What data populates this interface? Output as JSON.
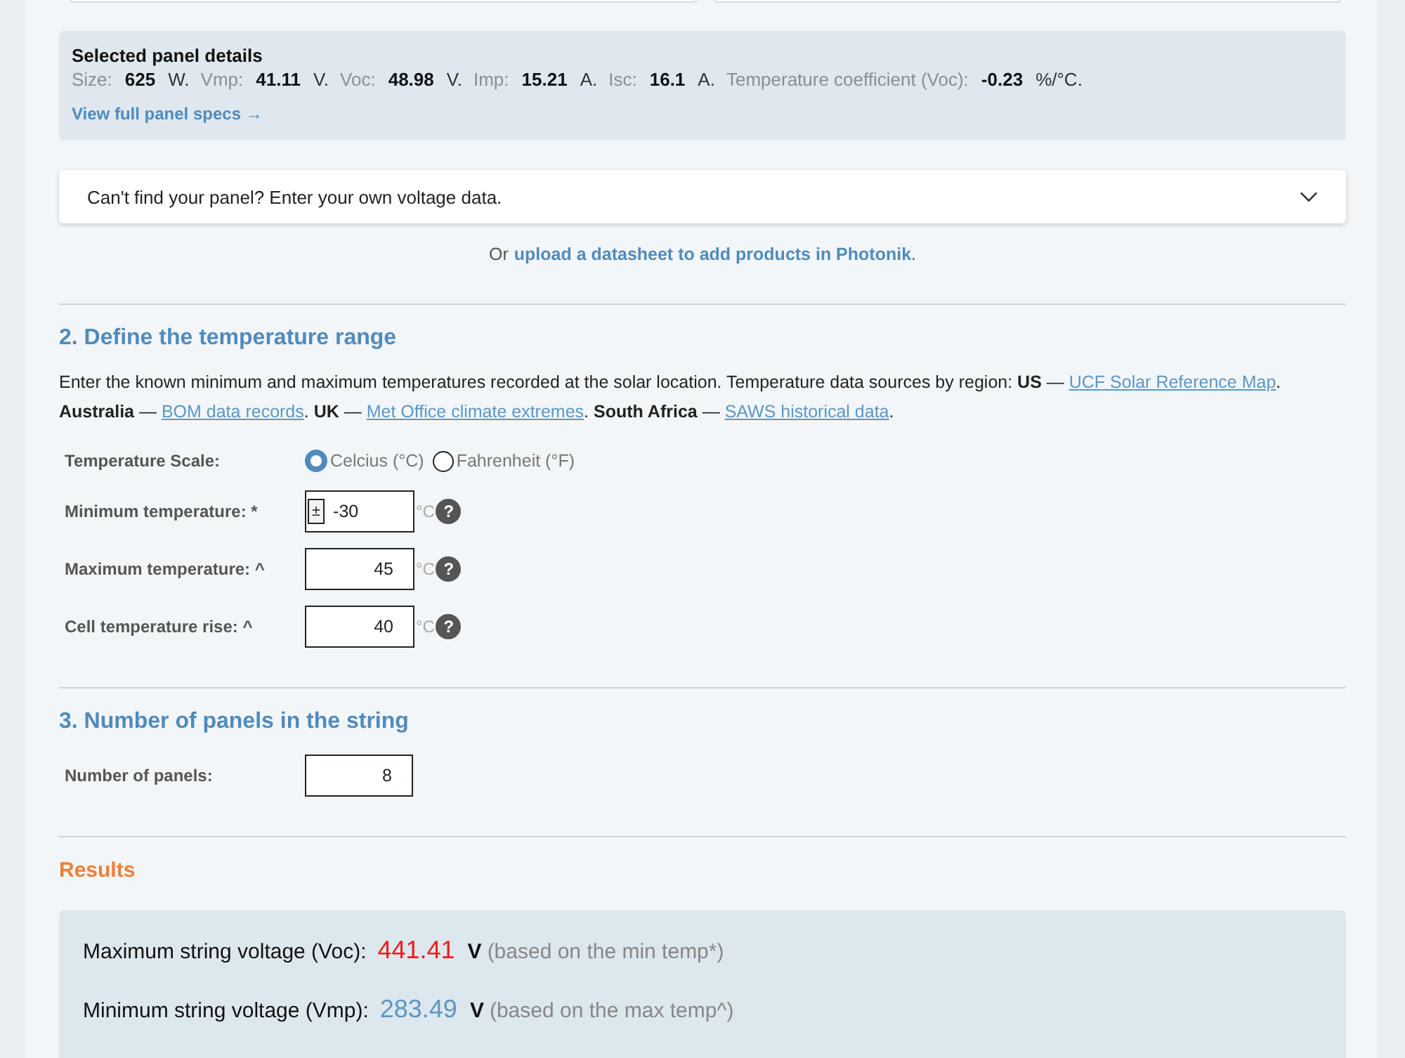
{
  "panel_details": {
    "title": "Selected panel details",
    "specs": [
      {
        "label": "Size:",
        "value": "625",
        "unit": "W."
      },
      {
        "label": "Vmp:",
        "value": "41.11",
        "unit": "V."
      },
      {
        "label": "Voc:",
        "value": "48.98",
        "unit": "V."
      },
      {
        "label": "Imp:",
        "value": "15.21",
        "unit": "A."
      },
      {
        "label": "Isc:",
        "value": "16.1",
        "unit": "A."
      },
      {
        "label": "Temperature coefficient (Voc):",
        "value": "-0.23",
        "unit": "%/°C."
      }
    ],
    "link": "View full panel specs →"
  },
  "custom_entry": {
    "label": "Can't find your panel? Enter your own voltage data.",
    "expanded": false
  },
  "upload_note": {
    "prefix": "Or",
    "link": "upload a datasheet to add products in Photonik",
    "suffix": "."
  },
  "temperature_section": {
    "heading": "2. Define the temperature range",
    "description": [
      {
        "kind": "text",
        "text": "Enter the known minimum and maximum temperatures recorded at the solar location. Temperature data sources by region: **US** — "
      },
      {
        "kind": "link",
        "text": "UCF Solar Reference Map"
      },
      {
        "kind": "text",
        "text": ". **Australia** — "
      },
      {
        "kind": "link",
        "text": "BOM data records"
      },
      {
        "kind": "text",
        "text": ". **UK** — "
      },
      {
        "kind": "link",
        "text": "Met Office climate extremes"
      },
      {
        "kind": "text",
        "text": ". **South Africa** — "
      },
      {
        "kind": "link",
        "text": "SAWS historical data"
      },
      {
        "kind": "text",
        "text": "."
      }
    ],
    "scale": {
      "label": "Temperature Scale:",
      "options": [
        {
          "label": "Celcius (°C)",
          "selected": true
        },
        {
          "label": "Fahrenheit (°F)",
          "selected": false
        }
      ]
    },
    "fields": [
      {
        "kind": "signed",
        "label": "Minimum temperature: *",
        "sign": "±",
        "value": "-30",
        "unit": "°C",
        "help": "?"
      },
      {
        "kind": "plain",
        "label": "Maximum temperature: ^",
        "value": "45",
        "unit": "°C",
        "help": "?"
      },
      {
        "kind": "plain",
        "label": "Cell temperature rise: ^",
        "value": "40",
        "unit": "°C",
        "help": "?"
      }
    ]
  },
  "panels_section": {
    "heading": "3. Number of panels in the string",
    "fields": [
      {
        "label": "Number of panels:",
        "value": "8"
      }
    ]
  },
  "results": {
    "heading": "Results",
    "rows": [
      {
        "label": "Maximum string voltage (Voc):",
        "value": "441.41",
        "color": "#ee1c1c",
        "unit": "V",
        "note": "(based on the min temp*)"
      },
      {
        "label": "Minimum string voltage (Vmp):",
        "value": "283.49",
        "color": "#5b97c4",
        "unit": "V",
        "note": "(based on the max temp^)"
      }
    ]
  }
}
